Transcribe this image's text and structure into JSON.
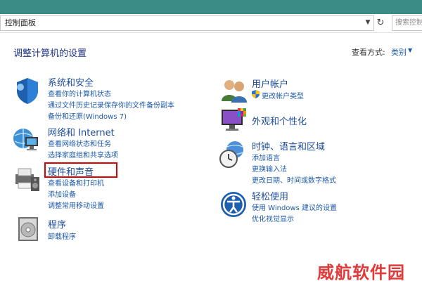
{
  "address": {
    "path": "控制面板",
    "search_placeholder": "搜索控制面板"
  },
  "header": {
    "title": "调整计算机的设置",
    "view_by_label": "查看方式:",
    "view_by_value": "类别"
  },
  "categories": {
    "system": {
      "heading": "系统和安全",
      "links": [
        "查看你的计算机状态",
        "通过文件历史记录保存你的文件备份副本",
        "备份和还原(Windows 7)"
      ]
    },
    "network": {
      "heading": "网络和 Internet",
      "links": [
        "查看网络状态和任务",
        "选择家庭组和共享选项"
      ]
    },
    "hardware": {
      "heading": "硬件和声音",
      "links": [
        "查看设备和打印机",
        "添加设备",
        "调整常用移动设置"
      ]
    },
    "programs": {
      "heading": "程序",
      "links": [
        "卸载程序"
      ]
    },
    "accounts": {
      "heading": "用户帐户",
      "links": [
        "更改帐户类型"
      ]
    },
    "appearance": {
      "heading": "外观和个性化",
      "links": []
    },
    "clock": {
      "heading": "时钟、语言和区域",
      "links": [
        "添加语言",
        "更换输入法",
        "更改日期、时间或数字格式"
      ]
    },
    "ease": {
      "heading": "轻松使用",
      "links": [
        "使用 Windows 建议的设置",
        "优化视觉显示"
      ]
    }
  },
  "watermark": "威航软件园",
  "colors": {
    "titlebar": "#3b8b86",
    "heading": "#1e4c9a",
    "link": "#1e5aa8",
    "highlight": "#d90000"
  }
}
